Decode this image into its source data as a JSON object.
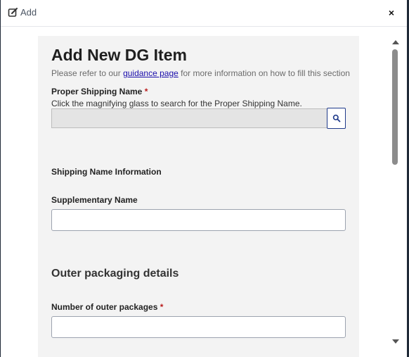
{
  "dialog": {
    "title": "Add",
    "close_label": "×"
  },
  "form": {
    "heading": "Add New DG Item",
    "help_prefix": "Please refer to our",
    "help_link": "guidance page",
    "help_suffix": "for more information on how to fill this section",
    "psn_label": "Proper Shipping Name",
    "psn_required": "*",
    "psn_hint": "Click the magnifying glass to search for the Proper Shipping Name.",
    "psn_value": "",
    "shipping_info_label": "Shipping Name Information",
    "supplementary_label": "Supplementary Name",
    "supplementary_value": "",
    "outer_section_heading": "Outer packaging details",
    "outer_count_label": "Number of outer packages",
    "outer_count_required": "*",
    "outer_count_value": ""
  },
  "icons": {
    "title": "edit-icon",
    "search": "search-icon",
    "close": "close-icon"
  },
  "colors": {
    "link": "#1a0dab",
    "required": "#b91c1c",
    "search_border": "#1f3a8a",
    "card_bg": "#f3f3f3"
  }
}
